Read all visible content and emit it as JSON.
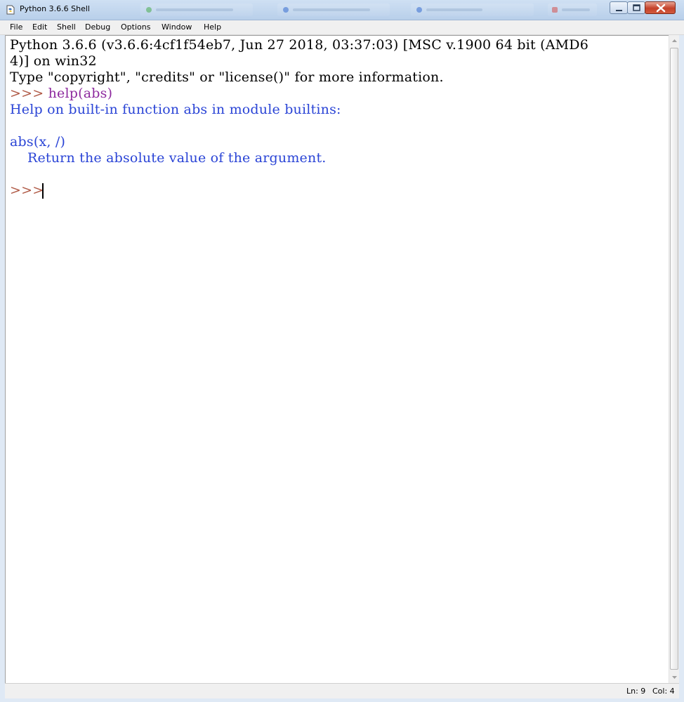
{
  "window": {
    "title": "Python 3.6.6 Shell"
  },
  "menu": {
    "items": [
      "File",
      "Edit",
      "Shell",
      "Debug",
      "Options",
      "Window",
      "Help"
    ]
  },
  "shell": {
    "lines": [
      {
        "segments": [
          {
            "text": "Python 3.6.6 (v3.6.6:4cf1f54eb7, Jun 27 2018, 03:37:03) [MSC v.1900 64 bit (AMD6",
            "role": "black"
          }
        ]
      },
      {
        "segments": [
          {
            "text": "4)] on win32",
            "role": "black"
          }
        ]
      },
      {
        "segments": [
          {
            "text": "Type \"copyright\", \"credits\" or \"license()\" for more information.",
            "role": "black"
          }
        ]
      },
      {
        "segments": [
          {
            "text": ">>> ",
            "role": "prompt"
          },
          {
            "text": "help(abs)",
            "role": "cmd"
          }
        ]
      },
      {
        "segments": [
          {
            "text": "Help on built-in function abs in module builtins:",
            "role": "out"
          }
        ]
      },
      {
        "segments": [
          {
            "text": "",
            "role": "out"
          }
        ]
      },
      {
        "segments": [
          {
            "text": "abs(x, /)",
            "role": "out"
          }
        ]
      },
      {
        "segments": [
          {
            "text": "    Return the absolute value of the argument.",
            "role": "out"
          }
        ]
      },
      {
        "segments": [
          {
            "text": "",
            "role": "out"
          }
        ]
      },
      {
        "segments": [
          {
            "text": ">>> ",
            "role": "prompt"
          }
        ]
      }
    ]
  },
  "status": {
    "line": "Ln: 9",
    "col": "Col: 4"
  },
  "colors": {
    "prompt": "#b05a46",
    "command": "#8d2a9e",
    "output": "#2a44d6",
    "text": "#000000"
  },
  "icons": [
    "python-idle-icon",
    "minimize-icon",
    "maximize-icon",
    "close-icon",
    "scroll-up-icon",
    "scroll-down-icon"
  ]
}
